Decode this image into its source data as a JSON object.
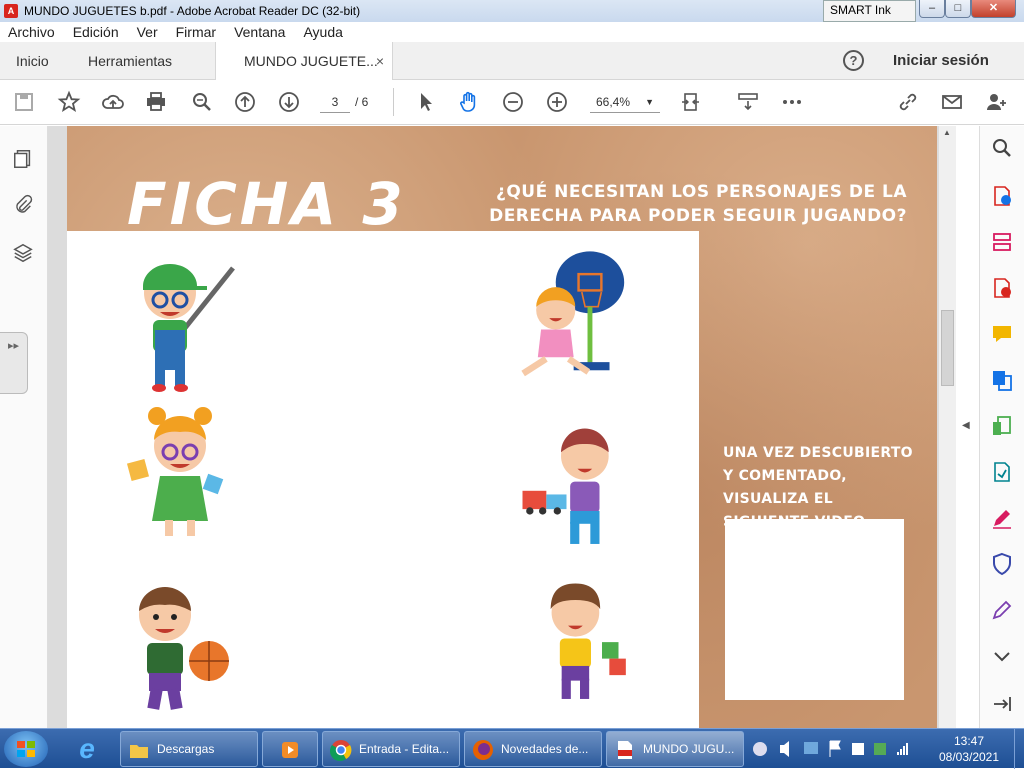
{
  "window": {
    "title": "MUNDO JUGUETES b.pdf - Adobe Acrobat Reader DC (32-bit)",
    "app_icon_label": "A",
    "smart_ink": "SMART Ink",
    "min_label": "–",
    "max_label": "□",
    "close_label": "✕"
  },
  "menu": [
    "Archivo",
    "Edición",
    "Ver",
    "Firmar",
    "Ventana",
    "Ayuda"
  ],
  "tabs": {
    "home": "Inicio",
    "tools": "Herramientas",
    "document": "MUNDO JUGUETE...",
    "close": "×",
    "help": "?",
    "signin": "Iniciar sesión"
  },
  "toolbar": {
    "page_current": "3",
    "page_total": "/ 6",
    "zoom": "66,4%",
    "zoom_caret": "▼"
  },
  "page": {
    "title": "FICHA 3",
    "question": "¿QUÉ NECESITAN LOS PERSONAJES DE LA DERECHA PARA PODER SEGUIR JUGANDO?",
    "side_text": "UNA VEZ DESCUBIERTO Y COMENTADO, VISUALIZA EL SIGUIENTE VIDEO"
  },
  "panels": {
    "left_arrow": "◀",
    "right_arrow": "◀",
    "handle": "▸▸",
    "scroll_up": "▲"
  },
  "taskbar": {
    "ie_label": "e",
    "items": [
      {
        "label": "Descargas"
      },
      {
        "label": ""
      },
      {
        "label": "Entrada - Edita..."
      },
      {
        "label": "Novedades de..."
      },
      {
        "label": "MUNDO JUGU..."
      }
    ],
    "time": "13:47",
    "date": "08/03/2021"
  },
  "colors": {
    "accent_blue": "#1473e6",
    "acrobat_red": "#d8251e",
    "page_brown": "#c9966f"
  }
}
